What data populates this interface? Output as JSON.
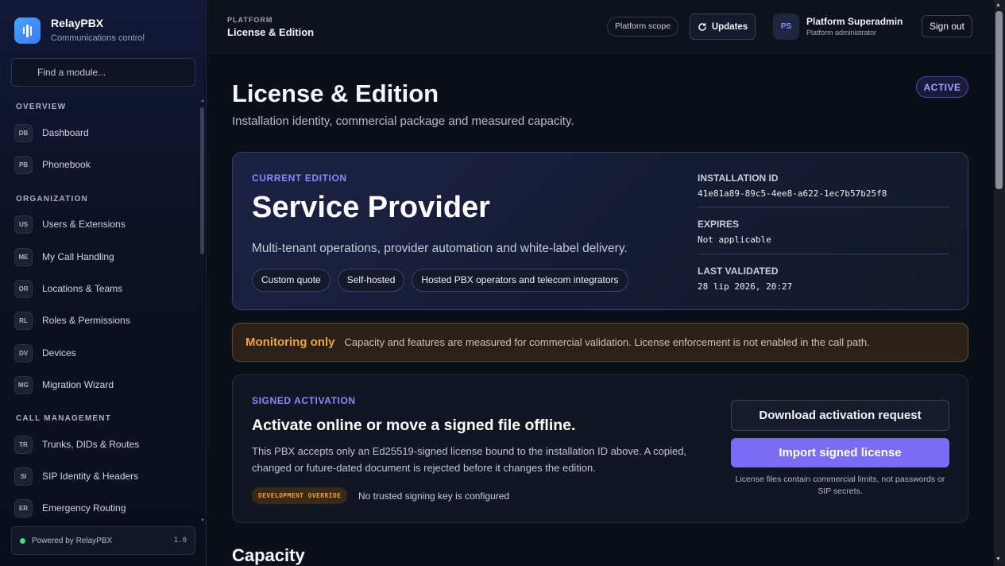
{
  "app": {
    "name": "RelayPBX",
    "subtitle": "Communications control",
    "search_placeholder": "Find a module...",
    "footer_label": "Powered by RelayPBX",
    "footer_version": "1.0"
  },
  "sidebar": {
    "sections": [
      {
        "label": "OVERVIEW",
        "items": [
          {
            "badge": "DB",
            "label": "Dashboard"
          },
          {
            "badge": "PB",
            "label": "Phonebook"
          }
        ]
      },
      {
        "label": "ORGANIZATION",
        "items": [
          {
            "badge": "US",
            "label": "Users & Extensions"
          },
          {
            "badge": "ME",
            "label": "My Call Handling"
          },
          {
            "badge": "OR",
            "label": "Locations & Teams"
          },
          {
            "badge": "RL",
            "label": "Roles & Permissions"
          },
          {
            "badge": "DV",
            "label": "Devices"
          },
          {
            "badge": "MG",
            "label": "Migration Wizard"
          }
        ]
      },
      {
        "label": "CALL MANAGEMENT",
        "items": [
          {
            "badge": "TR",
            "label": "Trunks, DIDs & Routes"
          },
          {
            "badge": "SI",
            "label": "SIP Identity & Headers"
          },
          {
            "badge": "ER",
            "label": "Emergency Routing"
          }
        ]
      }
    ]
  },
  "topbar": {
    "crumb": "PLATFORM",
    "title": "License & Edition",
    "scope": "Platform scope",
    "updates": "Updates",
    "user_initials": "PS",
    "user_name": "Platform Superadmin",
    "user_role": "Platform administrator",
    "signout": "Sign out"
  },
  "page": {
    "title": "License & Edition",
    "subtitle": "Installation identity, commercial package and measured capacity.",
    "status": "ACTIVE"
  },
  "edition": {
    "eyebrow": "CURRENT EDITION",
    "name": "Service Provider",
    "description": "Multi-tenant operations, provider automation and white-label delivery.",
    "tags": [
      "Custom quote",
      "Self-hosted",
      "Hosted PBX operators and telecom integrators"
    ],
    "installation_id_label": "INSTALLATION ID",
    "installation_id": "41e81a89-89c5-4ee8-a622-1ec7b57b25f8",
    "expires_label": "EXPIRES",
    "expires": "Not applicable",
    "validated_label": "LAST VALIDATED",
    "validated": "28 lip 2026, 20:27"
  },
  "monitoring": {
    "title": "Monitoring only",
    "text": "Capacity and features are measured for commercial validation. License enforcement is not enabled in the call path."
  },
  "activation": {
    "eyebrow": "SIGNED ACTIVATION",
    "title": "Activate online or move a signed file offline.",
    "body": "This PBX accepts only an Ed25519-signed license bound to the installation ID above. A copied, changed or future-dated document is rejected before it changes the edition.",
    "dev_badge": "DEVELOPMENT OVERRIDE",
    "dev_text": "No trusted signing key is configured",
    "download_btn": "Download activation request",
    "import_btn": "Import signed license",
    "note": "License files contain commercial limits, not passwords or SIP secrets."
  },
  "capacity": {
    "title": "Capacity"
  }
}
